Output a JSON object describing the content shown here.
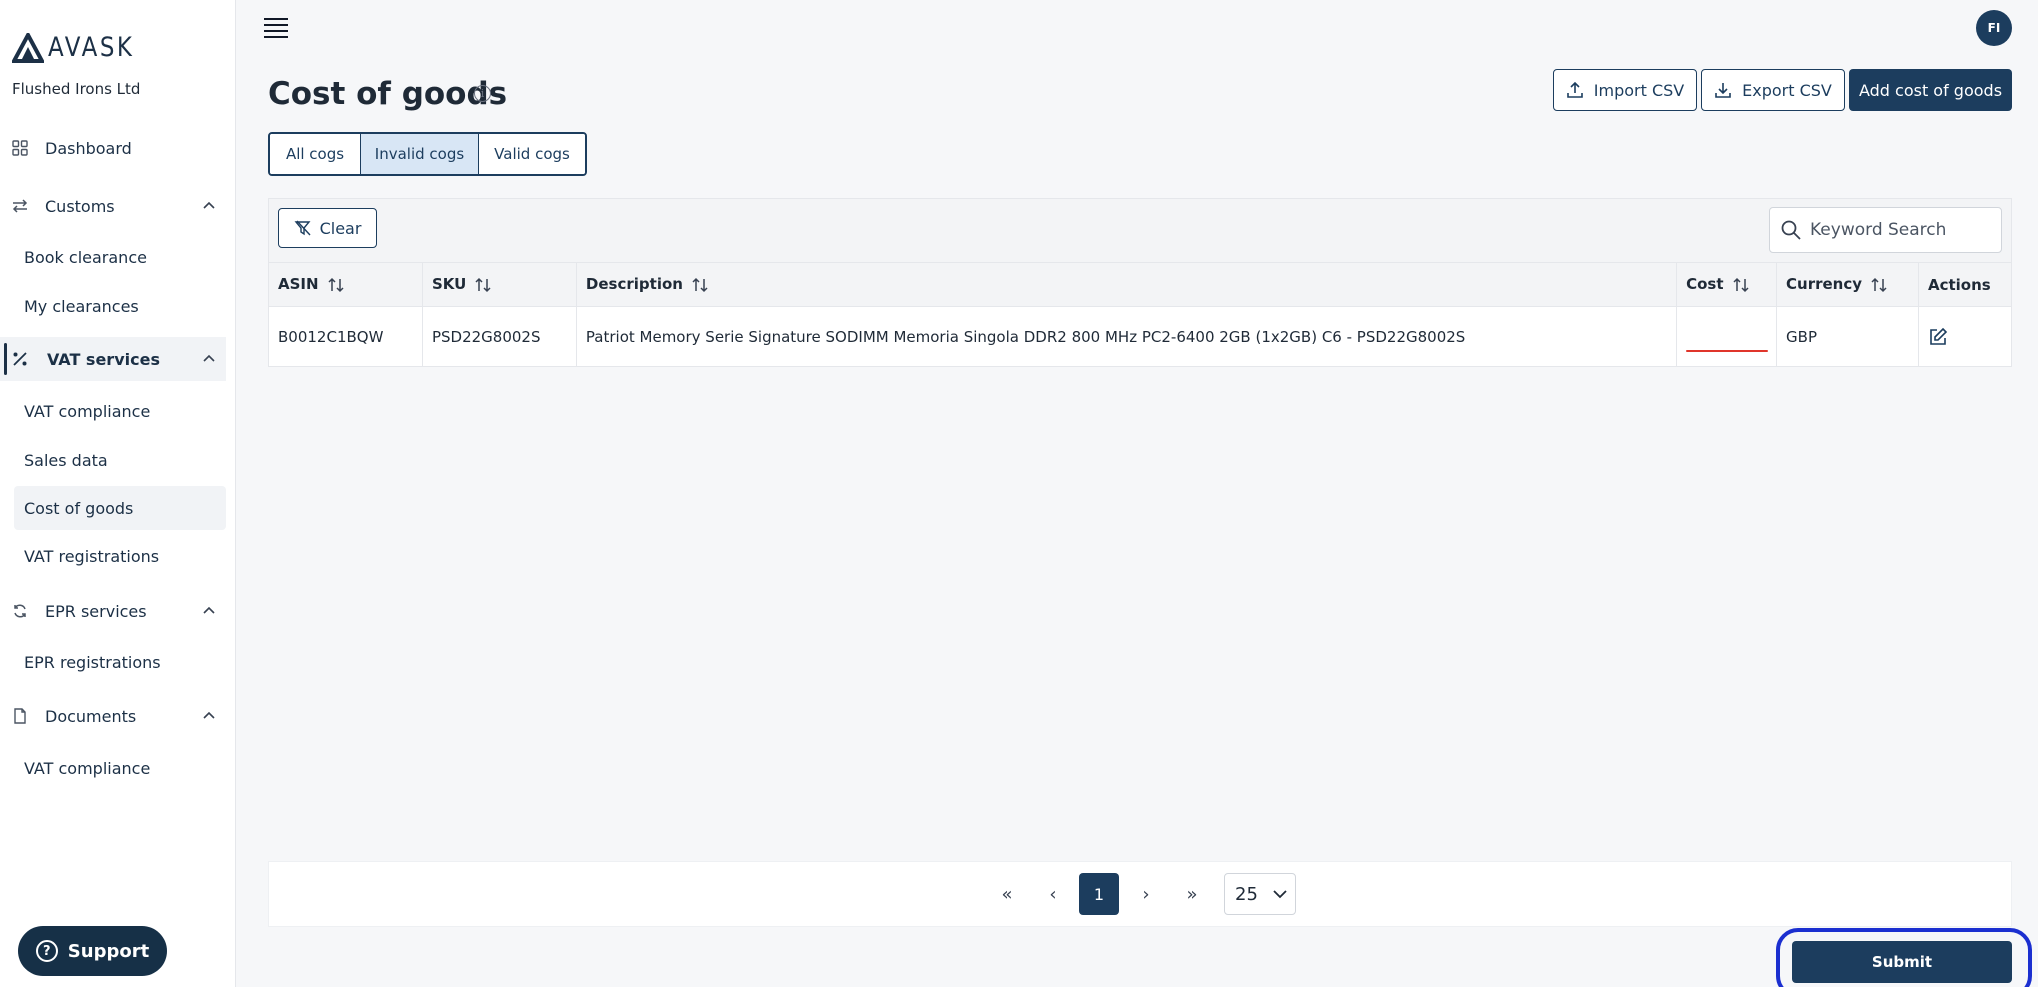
{
  "brand": {
    "logo_text": "AVASK",
    "company": "Flushed Irons Ltd"
  },
  "sidebar": {
    "dashboard": "Dashboard",
    "customs": "Customs",
    "book_clearance": "Book clearance",
    "my_clearances": "My clearances",
    "vat_services": "VAT services",
    "vat_compliance": "VAT compliance",
    "sales_data": "Sales data",
    "cost_of_goods": "Cost of goods",
    "vat_registrations": "VAT registrations",
    "epr_services": "EPR services",
    "epr_registrations": "EPR registrations",
    "documents": "Documents",
    "docs_vat_compliance": "VAT compliance",
    "support": "Support"
  },
  "header": {
    "avatar_initials": "FI"
  },
  "page": {
    "title": "Cost of goods",
    "import_csv": "Import CSV",
    "export_csv": "Export CSV",
    "add_cog": "Add cost of goods"
  },
  "tabs": {
    "all": "All cogs",
    "invalid": "Invalid cogs",
    "valid": "Valid cogs"
  },
  "filters": {
    "clear": "Clear",
    "search_placeholder": "Keyword Search"
  },
  "table": {
    "headers": {
      "asin": "ASIN",
      "sku": "SKU",
      "description": "Description",
      "cost": "Cost",
      "currency": "Currency",
      "actions": "Actions"
    },
    "rows": [
      {
        "asin": "B0012C1BQW",
        "sku": "PSD22G8002S",
        "description": "Patriot Memory Serie Signature SODIMM Memoria Singola DDR2 800 MHz PC2-6400 2GB (1x2GB) C6 - PSD22G8002S",
        "cost": "",
        "currency": "GBP"
      }
    ]
  },
  "pagination": {
    "current_page": "1",
    "page_size": "25"
  },
  "submit": "Submit",
  "colors": {
    "primary": "#1c3d5e",
    "active_tab": "#d8e6f5",
    "error": "#e0352b",
    "highlight_ring": "#1b2fd0"
  }
}
